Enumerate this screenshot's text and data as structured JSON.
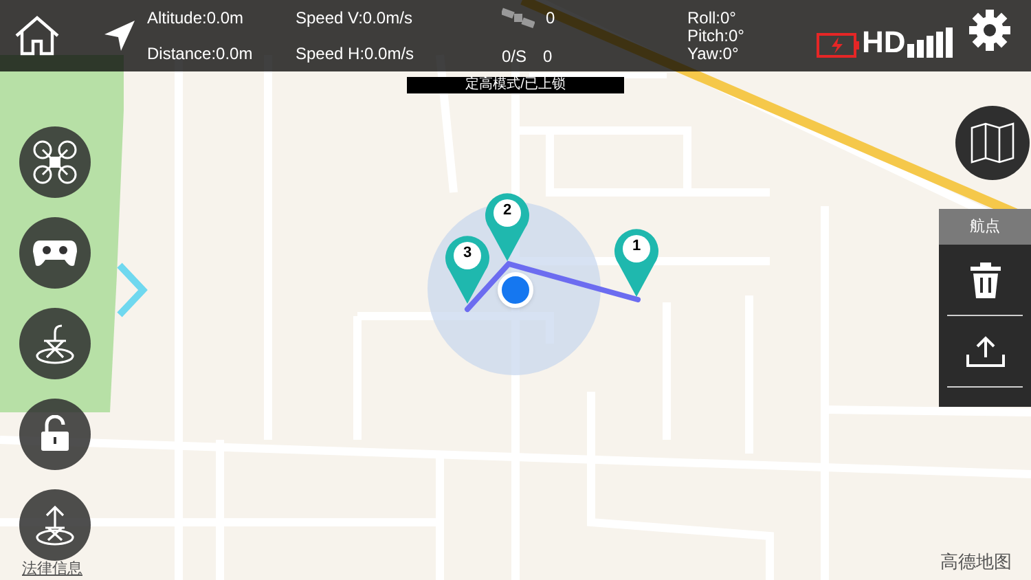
{
  "top_bar": {
    "altitude": "Altitude:0.0m",
    "distance": "Distance:0.0m",
    "speed_v": "Speed V:0.0m/s",
    "speed_h": "Speed H:0.0m/s",
    "satellites": "0",
    "sat_rate_label": "0/S",
    "sat_rate": "0",
    "roll": "Roll:0°",
    "pitch": "Pitch:0°",
    "yaw": "Yaw:0°",
    "video": "HD"
  },
  "mode_status": "定高模式/已上锁",
  "waypoint_panel": {
    "title": "航点"
  },
  "waypoints": [
    {
      "label": "1"
    },
    {
      "label": "2"
    },
    {
      "label": "3"
    }
  ],
  "map": {
    "attribution": "高德地图",
    "legal_link": "法律信息"
  }
}
